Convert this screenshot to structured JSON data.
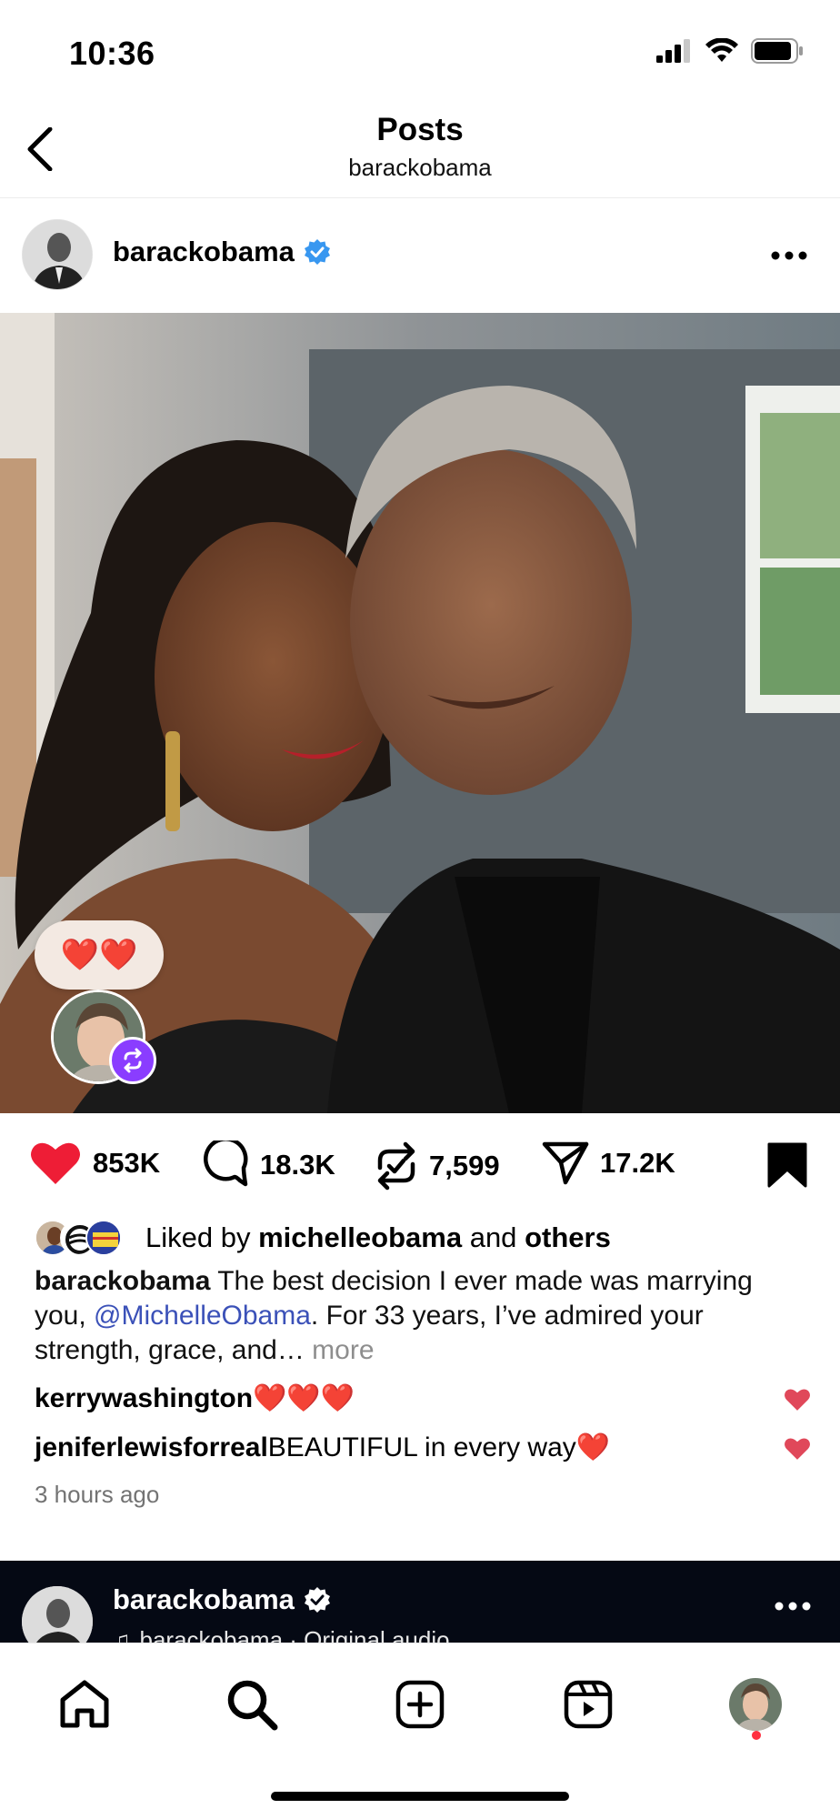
{
  "status_bar": {
    "time": "10:36"
  },
  "header": {
    "title": "Posts",
    "subtitle": "barackobama"
  },
  "post": {
    "username": "barackobama",
    "verified": true,
    "photo_alt": "",
    "thought_bubble": "❤️❤️",
    "stats": {
      "likes": "853K",
      "comments": "18.3K",
      "reposts": "7,599",
      "shares": "17.2K"
    },
    "likes_line": {
      "prefix": "Liked by",
      "user": "michelleobama",
      "conjunction": "and",
      "others": "others"
    },
    "caption": {
      "username": "barackobama",
      "text_before": " The best decision I ever made was marrying you, ",
      "mention": "@MichelleObama",
      "text_after": ". For 33 years, I’ve admired your strength, grace, and… ",
      "more": "more"
    },
    "comments": [
      {
        "username": "kerrywashington",
        "text": " ❤️❤️❤️"
      },
      {
        "username": "jeniferlewisforreal",
        "text": " BEAUTIFUL in every way❤️"
      }
    ],
    "timestamp": "3 hours ago"
  },
  "next_post": {
    "username": "barackobama",
    "audio": "barackobama · Original audio"
  },
  "colors": {
    "like_red": "#ee1d36",
    "mention_blue": "#3b51b8",
    "verified_blue": "#3897f0",
    "repost_purple": "#8a3dff",
    "reel_bg": "#050914"
  }
}
